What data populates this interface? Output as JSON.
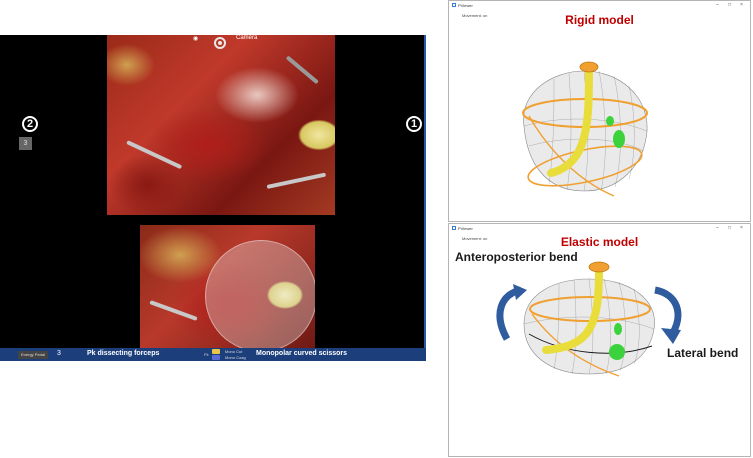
{
  "console": {
    "camera_label": "Camera",
    "arm_left_badge": "2",
    "arm_right_badge": "1",
    "arm_tab": "3",
    "statusbar": {
      "left_item": "Energy Pedal",
      "arm_number": "3",
      "left_tool": "Pk dissecting forceps",
      "right_tool": "Monopolar curved scissors",
      "mid_items": [
        "Mono Cut",
        "Mono Coag"
      ],
      "arm_small": "Pk"
    },
    "colors": {
      "statusbar": "#1c3f7c",
      "mid_cut": "#e8c64a",
      "mid_coag": "#5a6bd8"
    }
  },
  "viewer_top": {
    "app_name": "PViewer",
    "movement_label": "Movement: on",
    "model_title": "Rigid model",
    "window_controls": [
      "–",
      "□",
      "×"
    ]
  },
  "viewer_bottom": {
    "app_name": "PViewer",
    "movement_label": "Movement: on",
    "model_title": "Elastic model",
    "window_controls": [
      "–",
      "□",
      "×"
    ]
  },
  "annotations": {
    "anteroposterior": "Anteroposterior bend",
    "lateral": "Lateral bend"
  },
  "colors": {
    "title_red": "#c00000",
    "arrow_blue": "#2e5c9f",
    "urethra_yellow": "#f2e84a",
    "tumor_green": "#3bd23b",
    "contour_orange": "#f0a030"
  }
}
